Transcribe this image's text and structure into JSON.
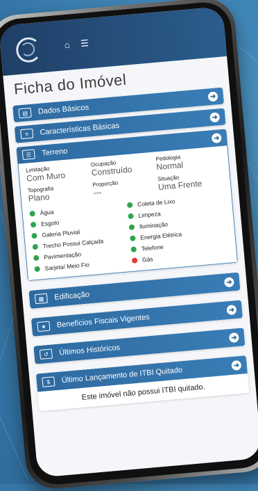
{
  "colors": {
    "accent": "#2d6aa0",
    "ok": "#2ea44f",
    "bad": "#e53935"
  },
  "header": {
    "icons": [
      "home-icon",
      "list-icon"
    ]
  },
  "page": {
    "title": "Ficha do Imóvel"
  },
  "sections": {
    "dados_basicos": "Dados Básicos",
    "caracteristicas": "Características Básicas",
    "terreno": "Terreno",
    "edificacao": "Edificação",
    "beneficios": "Benefícios Fiscais Vigentes",
    "historicos": "Últimos Históricos",
    "itbi": "Último Lançamento de ITBI Quitado"
  },
  "terreno": {
    "fields": [
      {
        "label": "Limitação",
        "value": "Com Muro"
      },
      {
        "label": "Ocupação",
        "value": "Construído"
      },
      {
        "label": "Pedologia",
        "value": "Normal"
      },
      {
        "label": "Topografia",
        "value": "Plano"
      },
      {
        "label": "Proporção",
        "value": "---"
      },
      {
        "label": "Situação",
        "value": "Uma Frente"
      }
    ],
    "services": [
      {
        "label": "Água",
        "status": "ok"
      },
      {
        "label": "Coleta de Lixo",
        "status": "ok"
      },
      {
        "label": "Esgoto",
        "status": "ok"
      },
      {
        "label": "Limpeza",
        "status": "ok"
      },
      {
        "label": "Galeria Pluvial",
        "status": "ok"
      },
      {
        "label": "Iluminação",
        "status": "ok"
      },
      {
        "label": "Trecho Possui Calçada",
        "status": "ok"
      },
      {
        "label": "Energia Elétrica",
        "status": "ok"
      },
      {
        "label": "Pavimentação",
        "status": "ok"
      },
      {
        "label": "Telefone",
        "status": "ok"
      },
      {
        "label": "Sarjeta/ Meio Fio",
        "status": "ok"
      },
      {
        "label": "Gás",
        "status": "bad"
      }
    ]
  },
  "itbi": {
    "message": "Este imóvel não possui ITBI quitado."
  }
}
